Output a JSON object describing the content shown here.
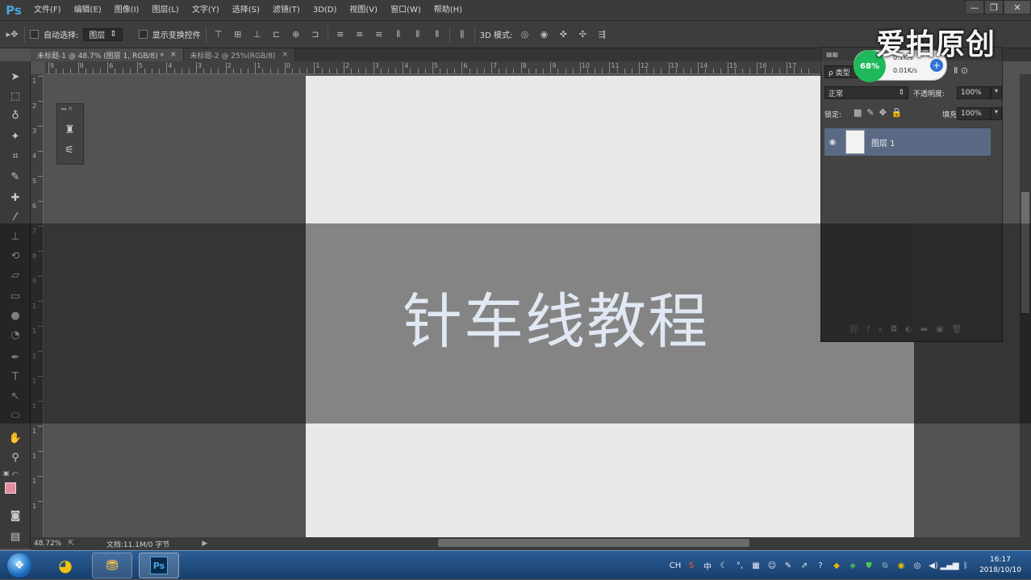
{
  "app": {
    "logo": "Ps"
  },
  "menu": [
    "文件(F)",
    "编辑(E)",
    "图像(I)",
    "图层(L)",
    "文字(Y)",
    "选择(S)",
    "滤镜(T)",
    "3D(D)",
    "视图(V)",
    "窗口(W)",
    "帮助(H)"
  ],
  "options": {
    "auto_select_label": "自动选择:",
    "auto_select_value": "图层",
    "show_transform_label": "显示变换控件",
    "mode_3d_label": "3D 模式:"
  },
  "tabs": [
    {
      "label": "未标题-1 @ 48.7% (图层 1, RGB/8) *",
      "close": "×"
    },
    {
      "label": "未标题-2 @ 25%(RGB/8)",
      "close": "×"
    }
  ],
  "ruler": {
    "h_labels": [
      "9",
      "8",
      "6",
      "5",
      "4",
      "3",
      "2",
      "1",
      "0",
      "1",
      "2",
      "3",
      "4",
      "5",
      "6",
      "7",
      "8",
      "9",
      "10",
      "11",
      "12",
      "13",
      "14",
      "15",
      "16",
      "17"
    ],
    "v_labels": [
      "1",
      "2",
      "3",
      "4",
      "5",
      "6",
      "7",
      "8",
      "9",
      "1",
      "1",
      "1",
      "1",
      "1",
      "1",
      "1",
      "1",
      "1"
    ]
  },
  "layers_panel": {
    "search_label": "ρ 类型",
    "blend_mode": "正常",
    "opacity_label": "不透明度:",
    "opacity_value": "100%",
    "lock_label": "锁定:",
    "fill_label": "填充:",
    "fill_value": "100%",
    "layer_name": "图层 1"
  },
  "status": {
    "zoom": "48.72%",
    "doc_info": "文档:11.1M/0 字节"
  },
  "overlay": {
    "title": "针车线教程"
  },
  "watermark": {
    "text": "爱拍原创"
  },
  "net_widget": {
    "percent": "68%",
    "up": "0.1K/s",
    "down": "0.01K/s"
  },
  "taskbar": {
    "time": "16:17",
    "date": "2018/10/10",
    "tray_ime": "CH",
    "tray_zh": "中"
  }
}
